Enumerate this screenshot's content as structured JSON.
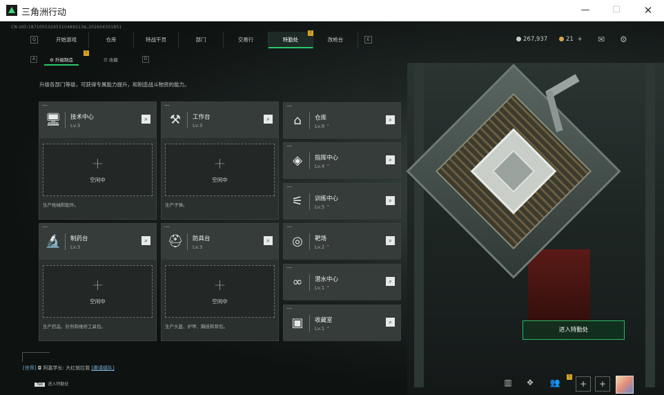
{
  "window": {
    "title": "三角洲行动",
    "min": "—",
    "max": "☐",
    "close": "✕"
  },
  "uid": "CN UID:18710553295310489213&,202604301851",
  "nav": {
    "left_key": "Q",
    "right_key": "E",
    "tabs": [
      {
        "label": "开始游戏"
      },
      {
        "label": "仓库"
      },
      {
        "label": "特战干员"
      },
      {
        "label": "部门"
      },
      {
        "label": "交易行"
      },
      {
        "label": "特勤处",
        "active": true,
        "badge": "!"
      },
      {
        "label": "改枪台"
      }
    ]
  },
  "resources": {
    "currency": "267,937",
    "tickets": "21",
    "tickets_add": "+",
    "mail_icon": "✉",
    "settings_icon": "⚙"
  },
  "subnav": {
    "left_key": "A",
    "right_key": "D",
    "tabs": [
      {
        "label": "升级制造",
        "active": true,
        "badge": "!"
      },
      {
        "label": "收藏"
      }
    ]
  },
  "description": "升级各部门等级，可获得专属能力提升，和制造战斗物资的能力。",
  "facilities_big": [
    {
      "name": "技术中心",
      "level": "Lv.3",
      "icon": "monitor-icon",
      "glyph": "🖥",
      "slot": "空闲中",
      "plus": "+",
      "produce": "生产枪械和配件。"
    },
    {
      "name": "工作台",
      "level": "Lv.3",
      "icon": "tools-icon",
      "glyph": "⚒",
      "slot": "空闲中",
      "plus": "+",
      "produce": "生产子弹。"
    },
    {
      "name": "制药台",
      "level": "Lv.3",
      "icon": "microscope-icon",
      "glyph": "🔬",
      "slot": "空闲中",
      "plus": "+",
      "produce": "生产药品、针剂和维修工具包。"
    },
    {
      "name": "防具台",
      "level": "Lv.3",
      "icon": "armor-icon",
      "glyph": "⛑",
      "slot": "空闲中",
      "plus": "+",
      "produce": "生产头盔、护甲、胸挂和背包。"
    }
  ],
  "facilities_small": [
    {
      "name": "仓库",
      "level": "Lv.8",
      "icon": "warehouse-icon",
      "glyph": "⌂"
    },
    {
      "name": "指挥中心",
      "level": "Lv.4",
      "icon": "command-icon",
      "glyph": "◈"
    },
    {
      "name": "训练中心",
      "level": "Lv.5",
      "icon": "dumbbell-icon",
      "glyph": "⚟"
    },
    {
      "name": "靶场",
      "level": "Lv.2",
      "icon": "target-icon",
      "glyph": "◎"
    },
    {
      "name": "潜水中心",
      "level": "Lv.1",
      "icon": "diving-mask-icon",
      "glyph": "∞"
    },
    {
      "name": "收藏室",
      "level": "Lv.1",
      "icon": "collection-icon",
      "glyph": "▣"
    }
  ],
  "enter_button": "进入特勤处",
  "chat": {
    "channel": "[世界]",
    "user": "阿嘉学长",
    "message": "大红就拉我",
    "link": "[邀请组队]"
  },
  "tab_hint": {
    "key": "Tab",
    "label": "进入特勤处"
  },
  "colors": {
    "accent": "#27c96a",
    "badge": "#d5a521",
    "star": "#c9a340"
  }
}
